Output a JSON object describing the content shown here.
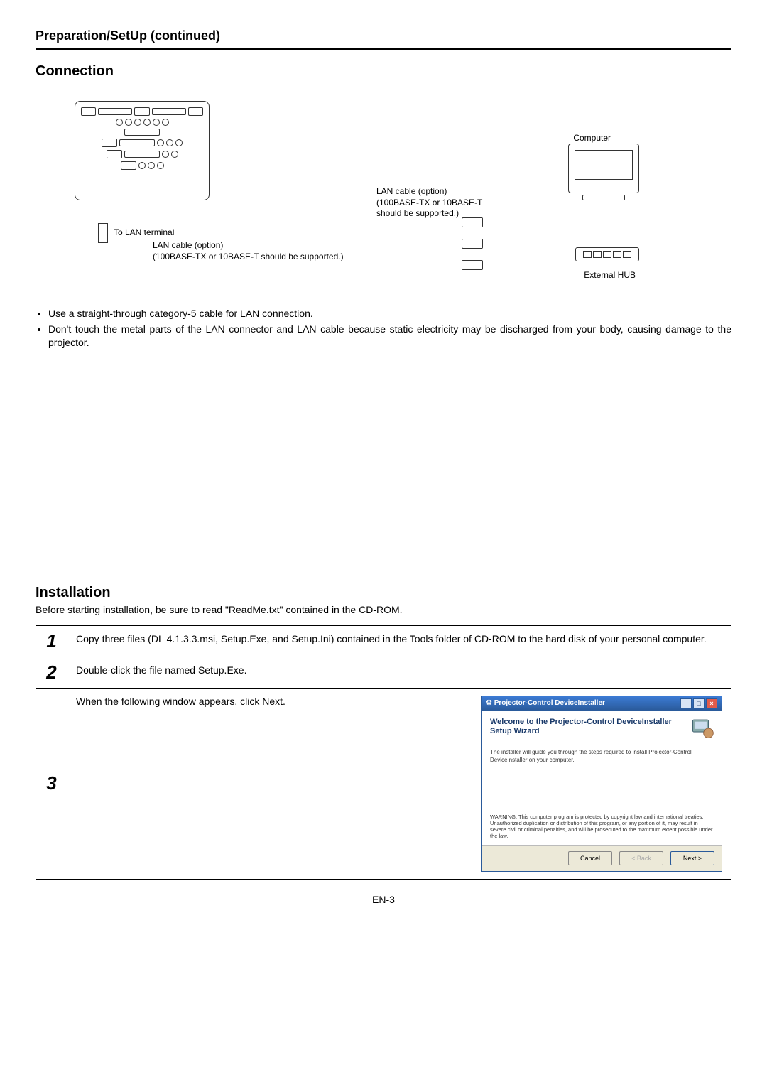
{
  "header": {
    "title": "Preparation/SetUp (continued)"
  },
  "section1": {
    "title": "Connection",
    "diagram": {
      "lanTerminal": "To LAN terminal",
      "lanCableLeft1": "LAN cable (option)",
      "lanCableLeft2": "(100BASE-TX or 10BASE-T should be supported.)",
      "lanCableRight1": "LAN cable (option)",
      "lanCableRight2": "(100BASE-TX or 10BASE-T",
      "lanCableRight3": "should be supported.)",
      "computerLabel": "Computer",
      "hubLabel": "External HUB"
    },
    "bullets": [
      "Use a straight-through category-5 cable for LAN connection.",
      "Don't touch the metal parts of the LAN connector and LAN cable because static electricity may be discharged from your body, causing damage to the projector."
    ]
  },
  "section2": {
    "title": "Installation",
    "intro": "Before starting installation, be sure to read \"ReadMe.txt\" contained in the CD-ROM.",
    "steps": [
      {
        "num": "1",
        "text": "Copy three files (DI_4.1.3.3.msi, Setup.Exe, and Setup.Ini) contained in the Tools folder of CD-ROM to the hard disk of your personal computer."
      },
      {
        "num": "2",
        "text": "Double-click the file named Setup.Exe."
      },
      {
        "num": "3",
        "text": "When the following window appears, click Next."
      }
    ]
  },
  "wizard": {
    "title": "Projector-Control DeviceInstaller",
    "heading": "Welcome to the Projector-Control DeviceInstaller Setup Wizard",
    "desc": "The installer will guide you through the steps required to install Projector-Control DeviceInstaller on your computer.",
    "warning": "WARNING: This computer program is protected by copyright law and international treaties. Unauthorized duplication or distribution of this program, or any portion of it, may result in severe civil or criminal penalties, and will be prosecuted to the maximum extent possible under the law.",
    "buttons": {
      "cancel": "Cancel",
      "back": "< Back",
      "next": "Next >"
    }
  },
  "pageNum": "EN-3"
}
